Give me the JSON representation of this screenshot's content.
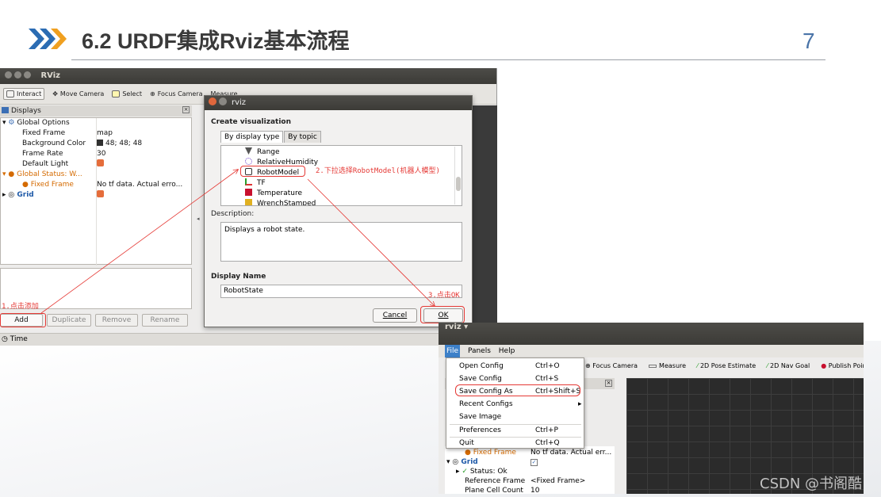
{
  "slide": {
    "title": "6.2 URDF集成Rviz基本流程",
    "page_number": "7",
    "accent_color": "#2b6cb3"
  },
  "rviz_main": {
    "window_title": "RViz",
    "toolbar": [
      {
        "label": "Interact",
        "icon": "cursor-hand-icon"
      },
      {
        "label": "Move Camera",
        "icon": "move-camera-icon"
      },
      {
        "label": "Select",
        "icon": "select-box-icon"
      },
      {
        "label": "Focus Camera",
        "icon": "focus-camera-icon"
      },
      {
        "label": "Measure",
        "icon": "ruler-icon"
      },
      {
        "label": "2D Pose Estimate",
        "icon": "green-arrow-icon"
      },
      {
        "label": "2D Nav Goal",
        "icon": "green-arrow-icon"
      },
      {
        "label": "Publish Point",
        "icon": "red-pin-icon"
      }
    ],
    "displays_title": "Displays",
    "tree": {
      "global_options": "Global Options",
      "fixed_frame_label": "Fixed Frame",
      "fixed_frame_value": "map",
      "bg_color_label": "Background Color",
      "bg_color_value": "48; 48; 48",
      "frame_rate_label": "Frame Rate",
      "frame_rate_value": "30",
      "default_light_label": "Default Light",
      "global_status_label": "Global Status: W...",
      "fixed_frame_err_label": "Fixed Frame",
      "fixed_frame_err_value": "No tf data.  Actual erro...",
      "grid_label": "Grid"
    },
    "buttons": {
      "add": "Add",
      "duplicate": "Duplicate",
      "remove": "Remove",
      "rename": "Rename"
    },
    "time_label": "Time"
  },
  "dialog": {
    "title": "rviz",
    "create_label": "Create visualization",
    "tab_display_type": "By display type",
    "tab_topic": "By topic",
    "items": [
      "Range",
      "RelativeHumidity",
      "RobotModel",
      "TF",
      "Temperature",
      "WrenchStamped"
    ],
    "description_label": "Description:",
    "description_text": "Displays a robot state.",
    "display_name_label": "Display Name",
    "display_name_value": "RobotState",
    "cancel": "Cancel",
    "ok": "OK"
  },
  "annotations": {
    "step1": "1.点击添加",
    "step2": "2.下拉选择RobotModel(机器人模型)",
    "step3": "3.点击OK"
  },
  "rviz_second": {
    "window_title": "rviz ▾",
    "menu_bar": [
      "File",
      "Panels",
      "Help"
    ],
    "toolbar": [
      "Focus Camera",
      "Measure",
      "2D Pose Estimate",
      "2D Nav Goal",
      "Publish Point"
    ],
    "file_menu": [
      {
        "label": "Open Config",
        "shortcut": "Ctrl+O"
      },
      {
        "label": "Save Config",
        "shortcut": "Ctrl+S"
      },
      {
        "label": "Save Config As",
        "shortcut": "Ctrl+Shift+S"
      },
      {
        "label": "Recent Configs",
        "shortcut": ""
      },
      {
        "label": "Save Image",
        "shortcut": ""
      },
      {
        "label": "Preferences",
        "shortcut": "Ctrl+P"
      },
      {
        "label": "Quit",
        "shortcut": "Ctrl+Q"
      }
    ],
    "tree": {
      "fixed_frame_label": "Fixed Frame",
      "fixed_frame_value": "No tf data.  Actual err...",
      "grid_label": "Grid",
      "status_label": "Status: Ok",
      "ref_frame_label": "Reference Frame",
      "ref_frame_value": "<Fixed Frame>",
      "plane_cell_label": "Plane Cell Count",
      "plane_cell_value": "10"
    }
  },
  "watermark": "CSDN @书阁酷"
}
